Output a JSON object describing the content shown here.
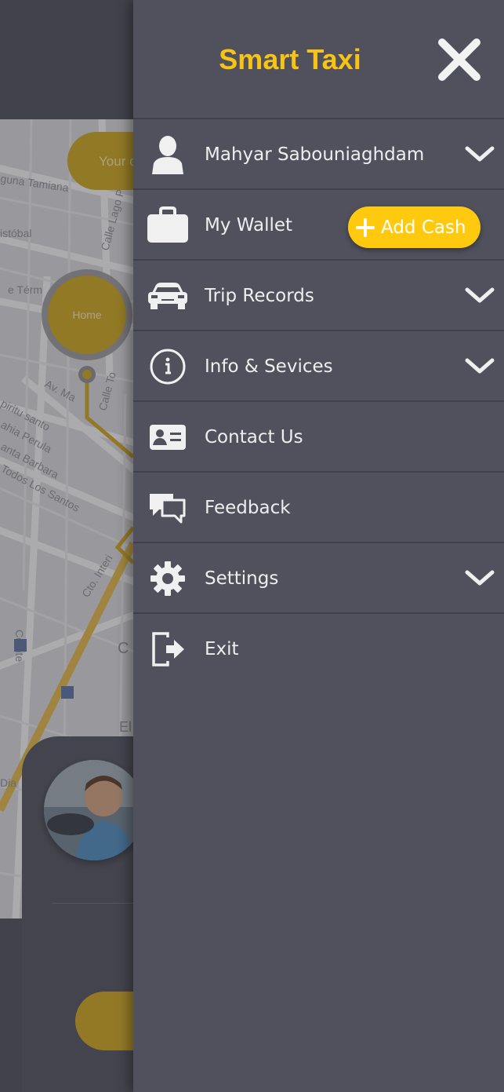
{
  "app": {
    "title": "Smart Taxi"
  },
  "background": {
    "search_placeholder": "Your c",
    "home_marker_label": "Home"
  },
  "menu": {
    "items": [
      {
        "label": "Mahyar Sabouniaghdam",
        "icon": "user-icon",
        "expandable": true
      },
      {
        "label": "My Wallet",
        "icon": "wallet-icon",
        "expandable": false,
        "action_label": "Add Cash"
      },
      {
        "label": "Trip Records",
        "icon": "car-icon",
        "expandable": true
      },
      {
        "label": "Info & Sevices",
        "icon": "info-icon",
        "expandable": true
      },
      {
        "label": "Contact Us",
        "icon": "contact-card-icon",
        "expandable": false
      },
      {
        "label": "Feedback",
        "icon": "feedback-icon",
        "expandable": false
      },
      {
        "label": "Settings",
        "icon": "gear-icon",
        "expandable": true
      },
      {
        "label": "Exit",
        "icon": "exit-icon",
        "expandable": false
      }
    ]
  },
  "colors": {
    "accent": "#f7c314",
    "drawer_bg": "#50515c",
    "add_cash_bg": "#fec90e"
  }
}
